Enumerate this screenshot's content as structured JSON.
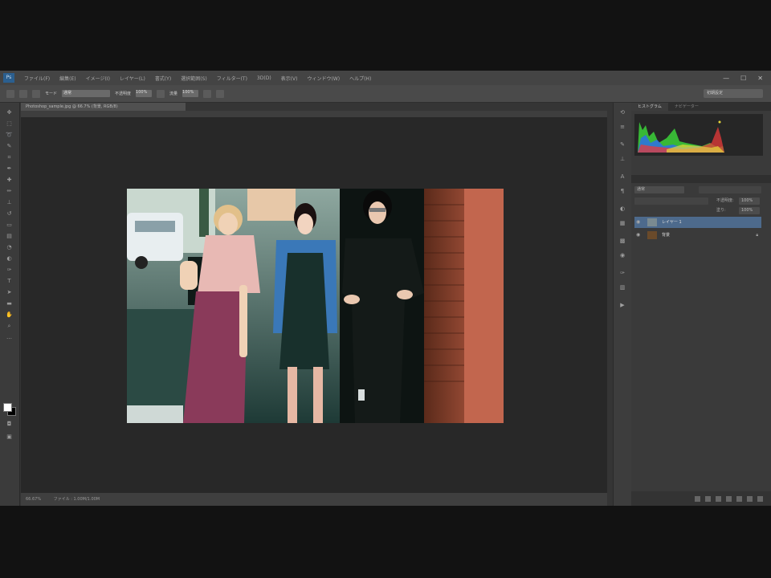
{
  "menu": {
    "logo": "Ps",
    "items": [
      "ファイル(F)",
      "編集(E)",
      "イメージ(I)",
      "レイヤー(L)",
      "書式(Y)",
      "選択範囲(S)",
      "フィルター(T)",
      "3D(D)",
      "表示(V)",
      "ウィンドウ(W)",
      "ヘルプ(H)"
    ],
    "window_controls": [
      "—",
      "☐",
      "✕"
    ]
  },
  "options_bar": {
    "mode_label": "モード",
    "mode_value": "通常",
    "opacity_label": "不透明度",
    "opacity_value": "100%",
    "flow_label": "流量",
    "flow_value": "100%",
    "workspace": "初期設定"
  },
  "document": {
    "tab_title": "Photoshop_sample.jpg @ 66.7% (背景, RGB/8)",
    "zoom": "66.67%",
    "doc_info": "ファイル : 1.00M/1.00M"
  },
  "panels": {
    "tabs": [
      "ヒストグラム",
      "ナビゲーター"
    ],
    "blend_mode": "通常",
    "opacity_label": "不透明度:",
    "opacity_value": "100%",
    "fill_label": "塗り:",
    "fill_value": "100%",
    "layers": [
      {
        "name": "レイヤー 1",
        "selected": true
      },
      {
        "name": "背景",
        "selected": false
      }
    ]
  },
  "colors": {
    "accent": "#4a6fa0",
    "selected_layer": "#4d6a8c"
  }
}
